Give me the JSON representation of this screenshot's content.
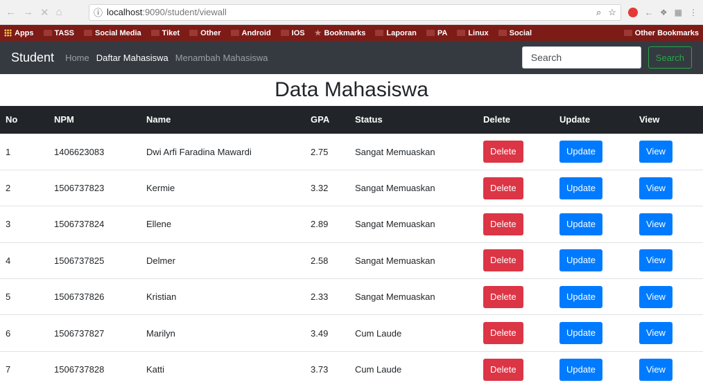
{
  "browser": {
    "url_host": "localhost",
    "url_rest": ":9090/student/viewall",
    "info_icon": "info-icon",
    "bookmarks": [
      {
        "label": "Apps",
        "icon": "apps-grid-icon"
      },
      {
        "label": "TASS",
        "icon": "folder-icon"
      },
      {
        "label": "Social Media",
        "icon": "folder-icon"
      },
      {
        "label": "Tiket",
        "icon": "folder-icon"
      },
      {
        "label": "Other",
        "icon": "folder-icon"
      },
      {
        "label": "Android",
        "icon": "folder-icon"
      },
      {
        "label": "IOS",
        "icon": "folder-icon"
      },
      {
        "label": "Bookmarks",
        "icon": "star-icon"
      },
      {
        "label": "Laporan",
        "icon": "folder-icon"
      },
      {
        "label": "PA",
        "icon": "folder-icon"
      },
      {
        "label": "Linux",
        "icon": "folder-icon"
      },
      {
        "label": "Social",
        "icon": "folder-icon"
      }
    ],
    "other_bookmarks": "Other Bookmarks"
  },
  "navbar": {
    "brand": "Student",
    "links": [
      {
        "label": "Home",
        "active": false
      },
      {
        "label": "Daftar Mahasiswa",
        "active": true
      },
      {
        "label": "Menambah Mahasiswa",
        "active": false
      }
    ],
    "search_placeholder": "Search",
    "search_button": "Search"
  },
  "page": {
    "title": "Data Mahasiswa"
  },
  "table": {
    "headers": [
      "No",
      "NPM",
      "Name",
      "GPA",
      "Status",
      "Delete",
      "Update",
      "View"
    ],
    "delete_label": "Delete",
    "update_label": "Update",
    "view_label": "View",
    "rows": [
      {
        "no": "1",
        "npm": "1406623083",
        "name": "Dwi Arfi Faradina Mawardi",
        "gpa": "2.75",
        "status": "Sangat Memuaskan"
      },
      {
        "no": "2",
        "npm": "1506737823",
        "name": "Kermie",
        "gpa": "3.32",
        "status": "Sangat Memuaskan"
      },
      {
        "no": "3",
        "npm": "1506737824",
        "name": "Ellene",
        "gpa": "2.89",
        "status": "Sangat Memuaskan"
      },
      {
        "no": "4",
        "npm": "1506737825",
        "name": "Delmer",
        "gpa": "2.58",
        "status": "Sangat Memuaskan"
      },
      {
        "no": "5",
        "npm": "1506737826",
        "name": "Kristian",
        "gpa": "2.33",
        "status": "Sangat Memuaskan"
      },
      {
        "no": "6",
        "npm": "1506737827",
        "name": "Marilyn",
        "gpa": "3.49",
        "status": "Cum Laude"
      },
      {
        "no": "7",
        "npm": "1506737828",
        "name": "Katti",
        "gpa": "3.73",
        "status": "Cum Laude"
      }
    ]
  },
  "colors": {
    "navbar_bg": "#343a40",
    "danger": "#dc3545",
    "primary": "#007bff",
    "success": "#28a745",
    "bookmarks_bar": "#7d1b17"
  }
}
